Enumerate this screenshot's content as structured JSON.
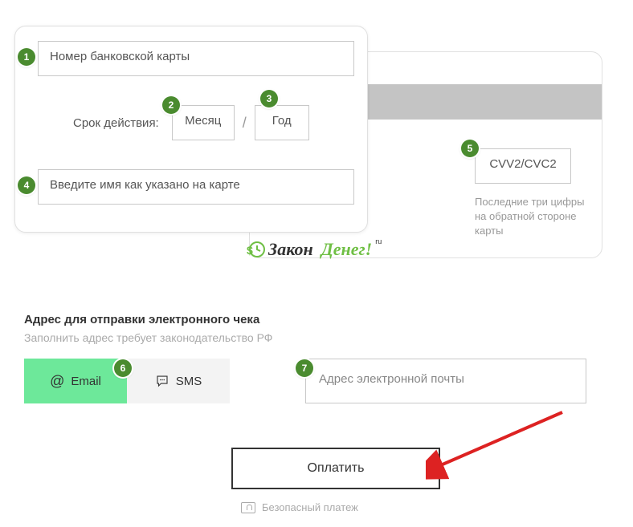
{
  "card": {
    "number_placeholder": "Номер банковской карты",
    "expiry_label": "Срок действия:",
    "month_placeholder": "Месяц",
    "year_placeholder": "Год",
    "holder_placeholder": "Введите имя как указано на карте",
    "cvv_placeholder": "CVV2/CVC2",
    "cvv_hint": "Последние три цифры на обратной стороне карты"
  },
  "logo": {
    "part1": "Закон",
    "part2": "Денег!",
    "ru": "ru"
  },
  "receipt": {
    "title": "Адрес для отправки электронного чека",
    "subtitle": "Заполнить адрес требует законодательство РФ",
    "tab_email": "Email",
    "tab_sms": "SMS",
    "email_placeholder": "Адрес электронной почты"
  },
  "pay_label": "Оплатить",
  "secure_label": "Безопасный платеж",
  "badges": {
    "b1": "1",
    "b2": "2",
    "b3": "3",
    "b4": "4",
    "b5": "5",
    "b6": "6",
    "b7": "7"
  }
}
